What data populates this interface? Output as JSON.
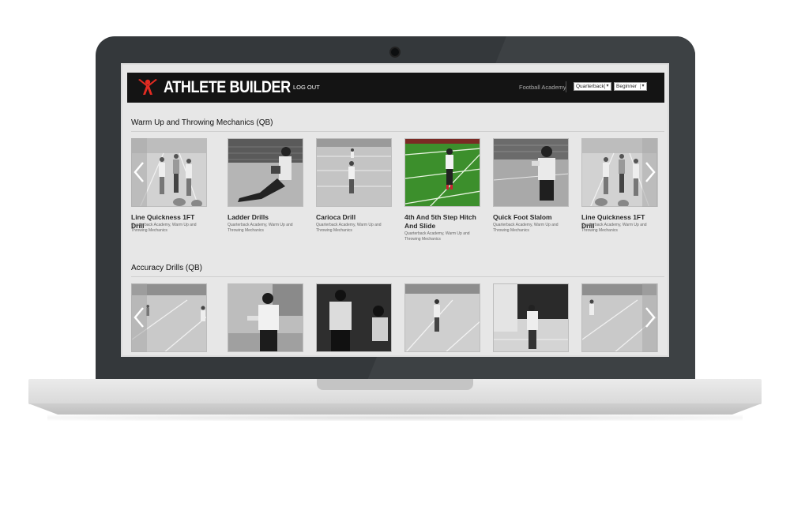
{
  "header": {
    "brand": "ATHLETE BUILDER",
    "logout_label": "LOG OUT",
    "academy_label": "Football Academy",
    "position_select": "Quarterback",
    "level_select": "Beginner",
    "brand_color": "#e32b22"
  },
  "sections": [
    {
      "title": "Warm Up and Throwing Mechanics (QB)",
      "cards": [
        {
          "title": "Line Quickness 1FT Drill",
          "meta": "Quarterback Academy, Warm Up and Throwing Mechanics"
        },
        {
          "title": "Ladder Drills",
          "meta": "Quarterback Academy, Warm Up and Throwing Mechanics"
        },
        {
          "title": "Carioca Drill",
          "meta": "Quarterback Academy, Warm Up and Throwing Mechanics"
        },
        {
          "title": "4th And 5th Step Hitch And Slide",
          "meta": "Quarterback Academy, Warm Up and Throwing Mechanics"
        },
        {
          "title": "Quick Foot Slalom",
          "meta": "Quarterback Academy, Warm Up and Throwing Mechanics"
        },
        {
          "title": "Line Quickness 1FT Drill",
          "meta": "Quarterback Academy, Warm Up and Throwing Mechanics"
        }
      ]
    },
    {
      "title": "Accuracy Drills (QB)",
      "cards": []
    }
  ],
  "icons": {
    "prev": "chevron-left-icon",
    "next": "chevron-right-icon",
    "logo": "athlete-logo-icon"
  }
}
